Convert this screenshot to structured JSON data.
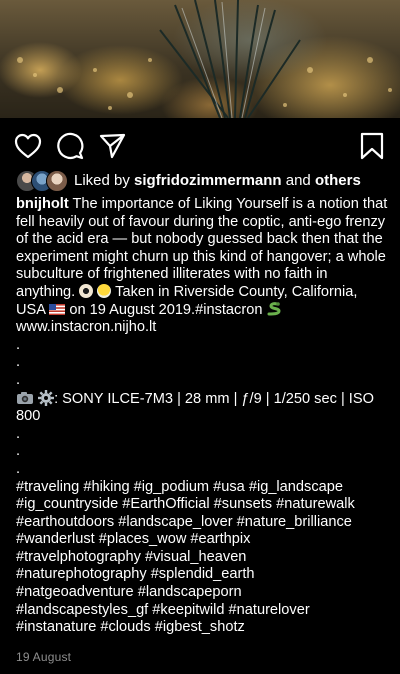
{
  "post": {
    "username": "bnijholt",
    "liked_by_prefix": "Liked by",
    "liked_by_user": "sigfridozimmermann",
    "liked_by_and": "and",
    "liked_by_others": "others",
    "caption_main": "The importance of Liking Yourself is a notion that fell heavily out of favour during the coptic, anti-ego frenzy of the acid era — but nobody guessed back then that the experiment might churn up this kind of hangover; a whole subculture of frightened illiterates with no faith in anything.",
    "caption_taken": "Taken in Riverside County, California, USA",
    "caption_date_part": "on 19 August 2019.",
    "caption_tag": "#instacron",
    "caption_link": "www.instacron.nijho.lt",
    "dot": ".",
    "camera_info": ": SONY ILCE-7M3 | 28 mm | ƒ/9 | 1/250 sec | ISO 800",
    "hashtags": [
      "#traveling #hiking #ig_podium #usa #ig_landscape",
      "#ig_countryside #EarthOfficial #sunsets #naturewalk",
      "#earthoutdoors #landscape_lover #nature_brilliance",
      "#wanderlust #places_wow #earthpix",
      "#travelphotography #visual_heaven",
      "#naturephotography #splendid_earth",
      "#natgeoadventure #landscapeporn",
      "#landscapestyles_gf #keepitwild #naturelover",
      "#instanature #clouds #igbest_shotz"
    ],
    "date": "19 August"
  },
  "icons": {
    "like": "heart-icon",
    "comment": "comment-icon",
    "share": "paper-plane-icon",
    "save": "bookmark-icon"
  },
  "colors": {
    "background": "#000000",
    "text": "#ffffff",
    "muted": "#8e8e8e"
  }
}
